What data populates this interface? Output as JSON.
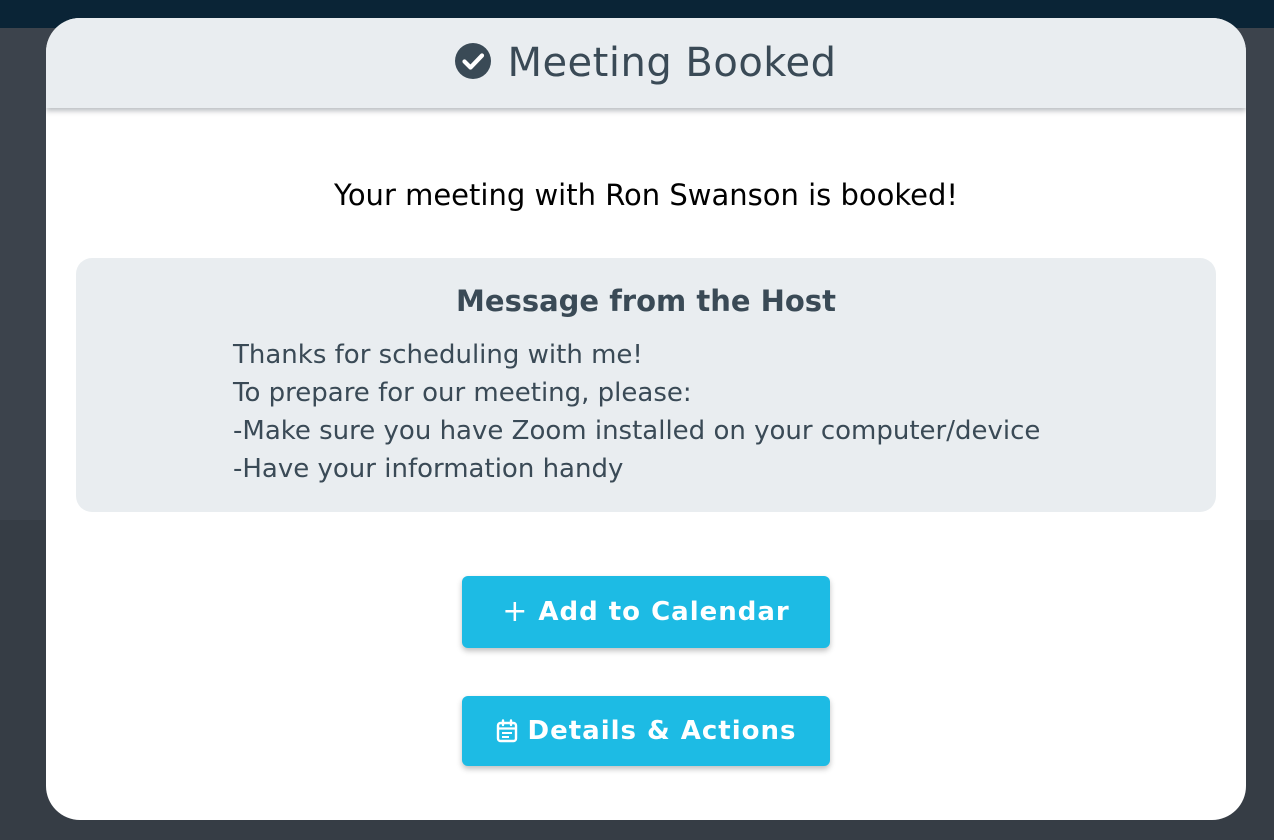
{
  "modal": {
    "title": "Meeting Booked",
    "title_icon": "check-circle-icon",
    "booked_message": "Your meeting with Ron Swanson is booked!"
  },
  "host_message": {
    "heading": "Message from the Host",
    "lines": [
      "Thanks for scheduling with me!",
      "To prepare for our meeting, please:",
      "-Make sure you have Zoom installed on your computer/device",
      "-Have your information handy"
    ]
  },
  "buttons": {
    "add_to_calendar": {
      "label": "Add to Calendar",
      "icon": "plus-icon",
      "icon_glyph": "+"
    },
    "details_actions": {
      "label": "Details & Actions",
      "icon": "calendar-icon"
    }
  },
  "colors": {
    "accent": "#1dbbe4",
    "header_bg": "#e9edf0",
    "text_dark": "#3a4a56",
    "backdrop": "#363d45",
    "topbar": "#0a2436"
  }
}
